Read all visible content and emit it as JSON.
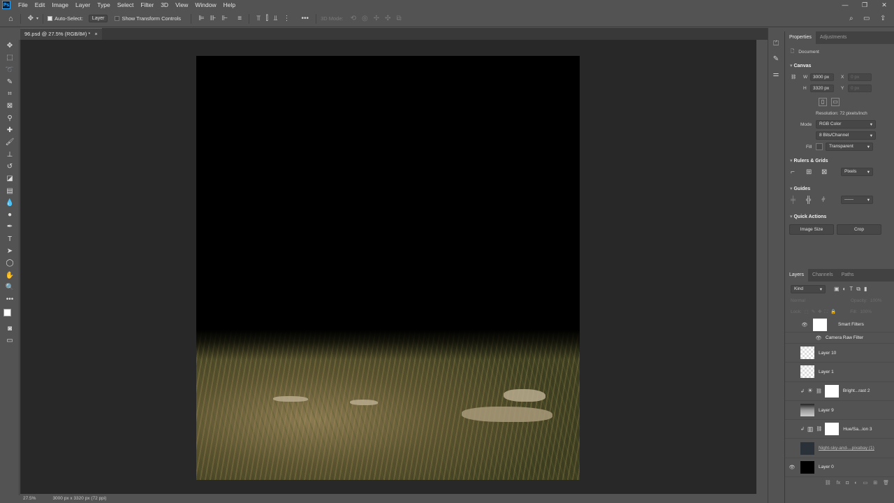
{
  "app": {
    "logo": "Ps"
  },
  "menu": [
    "File",
    "Edit",
    "Image",
    "Layer",
    "Type",
    "Select",
    "Filter",
    "3D",
    "View",
    "Window",
    "Help"
  ],
  "window_controls": [
    "—",
    "❐",
    "✕"
  ],
  "options": {
    "auto_select_label": "Auto-Select:",
    "auto_select_value": "Layer",
    "transform_controls_label": "Show Transform Controls",
    "three_d_mode_label": "3D Mode:"
  },
  "document": {
    "tab_title": "96.psd @ 27.5% (RGB/8#) *",
    "tab_close": "×"
  },
  "status": {
    "zoom": "27.5%",
    "doc_info": "3000 px x 3320 px (72 ppi)"
  },
  "properties": {
    "tabs": [
      "Properties",
      "Adjustments"
    ],
    "doc_label": "Document",
    "canvas_title": "Canvas",
    "w_label": "W",
    "w_value": "3000 px",
    "h_label": "H",
    "h_value": "3320 px",
    "x_label": "X",
    "x_value": "0 px",
    "y_label": "Y",
    "y_value": "0 px",
    "resolution": "Resolution: 72 pixels/inch",
    "mode_label": "Mode",
    "mode_value": "RGB Color",
    "bits_value": "8 Bits/Channel",
    "fill_label": "Fill",
    "fill_value": "Transparent",
    "rulers_title": "Rulers & Grids",
    "rulers_units": "Pixels",
    "guides_title": "Guides",
    "quick_actions_title": "Quick Actions",
    "image_size_btn": "Image Size",
    "crop_btn": "Crop"
  },
  "layers_panel": {
    "tabs": [
      "Layers",
      "Channels",
      "Paths"
    ],
    "kind_label": "Kind",
    "blend_mode": "Normal",
    "opacity_label": "Opacity:",
    "opacity_value": "100%",
    "lock_label": "Lock:",
    "fill_label": "Fill:",
    "fill_value": "100%",
    "items": [
      {
        "name": "Smart Filters"
      },
      {
        "name": "Camera Raw Filter"
      },
      {
        "name": "Layer 10"
      },
      {
        "name": "Layer 1"
      },
      {
        "name": "Bright...rast 2"
      },
      {
        "name": "Layer 9"
      },
      {
        "name": "Hue/Sa...ion 3"
      },
      {
        "name": "Night-sky-and-...pixabay (1)"
      },
      {
        "name": "Layer 0"
      }
    ]
  },
  "colors": {
    "accent": "#31a8ff",
    "foreground": "#ffffff",
    "background": "#000000"
  }
}
